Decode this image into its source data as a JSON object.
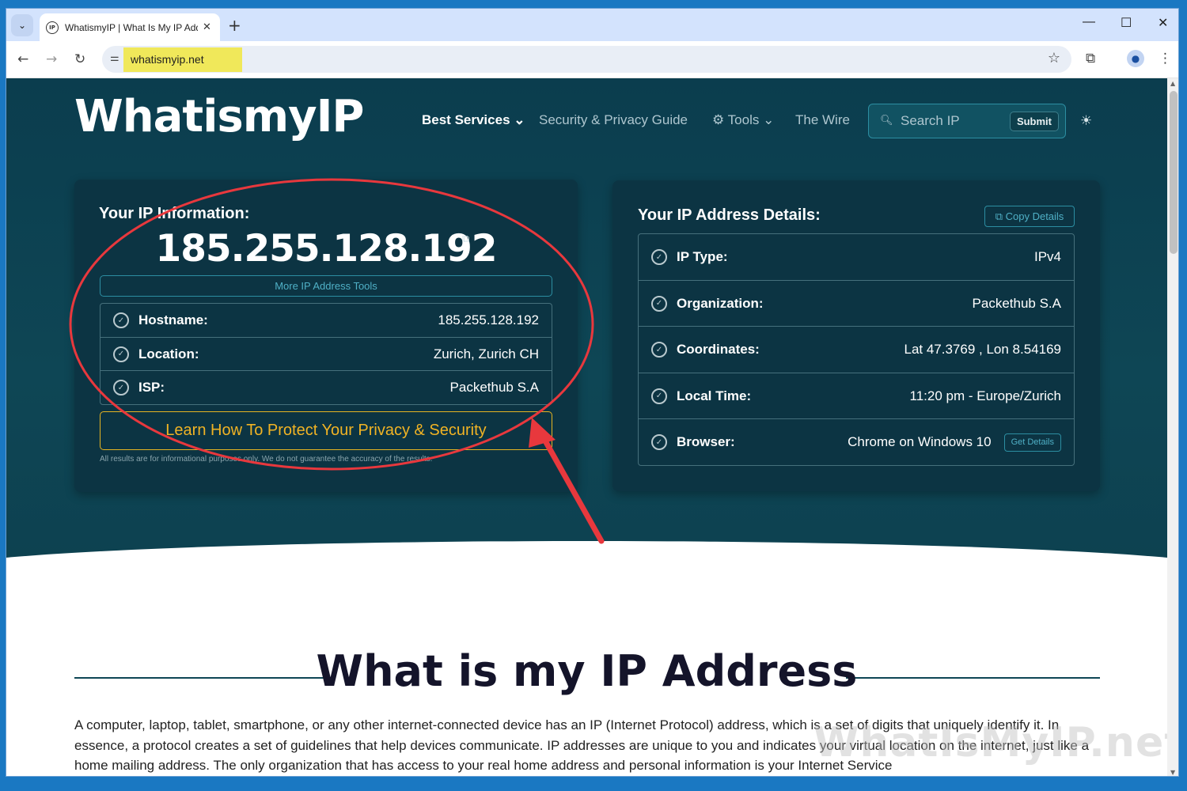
{
  "browser": {
    "tab_title": "WhatismyIP | What Is My IP Address",
    "url": "whatismyip.net",
    "favicon_text": "IP",
    "icons": {
      "tab_dropdown": "chevron-down-icon",
      "close": "close-icon",
      "new_tab": "plus-icon",
      "back": "back-arrow-icon",
      "forward": "forward-arrow-icon",
      "reload": "reload-icon",
      "site_info": "tune-icon",
      "bookmark": "star-icon",
      "extensions": "puzzle-icon",
      "profile": "person-icon",
      "menu": "kebab-menu-icon"
    }
  },
  "site": {
    "logo": "WhatismyIP",
    "nav": {
      "best_services": "Best Services",
      "guide": "Security & Privacy Guide",
      "tools": "Tools",
      "wire": "The Wire"
    },
    "search": {
      "placeholder": "Search IP",
      "submit": "Submit"
    }
  },
  "ip_info": {
    "title": "Your IP Information:",
    "ip": "185.255.128.192",
    "more_tools": "More IP Address Tools",
    "rows": [
      {
        "label": "Hostname:",
        "value": "185.255.128.192"
      },
      {
        "label": "Location:",
        "value": "Zurich, Zurich CH"
      },
      {
        "label": "ISP:",
        "value": "Packethub S.A"
      }
    ],
    "protect": "Learn How To Protect Your Privacy & Security",
    "disclaimer": "All results are for informational purposes only. We do not guarantee the accuracy of the results."
  },
  "ip_details": {
    "title": "Your IP Address Details:",
    "copy": "Copy Details",
    "rows": [
      {
        "label": "IP Type:",
        "value": "IPv4"
      },
      {
        "label": "Organization:",
        "value": "Packethub S.A"
      },
      {
        "label": "Coordinates:",
        "value": "Lat 47.3769 , Lon 8.54169"
      },
      {
        "label": "Local Time:",
        "value": "11:20 pm - Europe/Zurich"
      },
      {
        "label": "Browser:",
        "value": "Chrome on Windows 10"
      }
    ],
    "get_details": "Get Details"
  },
  "article": {
    "heading": "What is my IP Address",
    "paragraph": "A computer, laptop, tablet, smartphone, or any other internet-connected device has an IP (Internet Protocol) address, which is a set of digits that uniquely identify it. In essence, a protocol creates a set of guidelines that help devices communicate. IP addresses are unique to you and indicates your virtual location on the internet, just like a home mailing address. The only organization that has access to your real home address and personal information is your Internet Service",
    "watermark": "WhatIsMyIP.net"
  },
  "colors": {
    "hero": "#0e4655",
    "accent": "#2c8ea2",
    "cta": "#f1b324",
    "annotation": "#e8383d"
  }
}
